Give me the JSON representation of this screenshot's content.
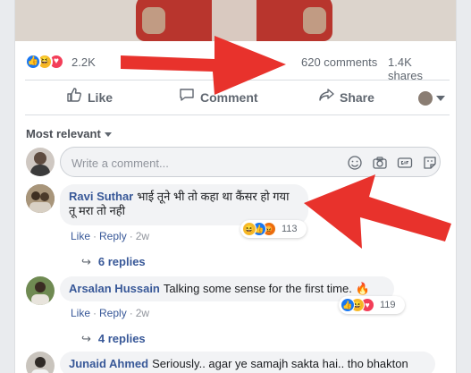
{
  "post": {
    "reaction_count": "2.2K",
    "comment_count": "620 comments",
    "share_count": "1.4K shares",
    "reaction_icons": [
      "like-icon",
      "haha-icon",
      "love-icon"
    ]
  },
  "actions": {
    "like_label": "Like",
    "comment_label": "Comment",
    "share_label": "Share"
  },
  "comments_header": {
    "sort_label": "Most relevant"
  },
  "comment_box": {
    "placeholder": "Write a comment...",
    "value": ""
  },
  "comments": [
    {
      "author": "Ravi Suthar",
      "text_line1": "भाई तूने भी तो कहा था कैंसर हो गया",
      "text_line2": "तू मरा तो नही",
      "like": "Like",
      "reply": "Reply",
      "time": "2w",
      "reaction_count": "113",
      "replies": "6 replies"
    },
    {
      "author": "Arsalan Hussain",
      "text": "Talking some sense for the first time. 🔥",
      "like": "Like",
      "reply": "Reply",
      "time": "2w",
      "reaction_count": "119",
      "replies": "4 replies"
    },
    {
      "author": "Junaid Ahmed",
      "text": "Seriously.. agar ye samajh sakta hai.. tho bhakton"
    }
  ],
  "colors": {
    "link": "#385898",
    "like_blue": "#1877f2",
    "love_red": "#f33e58",
    "haha_yellow": "#f7b928",
    "annotation_red": "#e8322c"
  }
}
